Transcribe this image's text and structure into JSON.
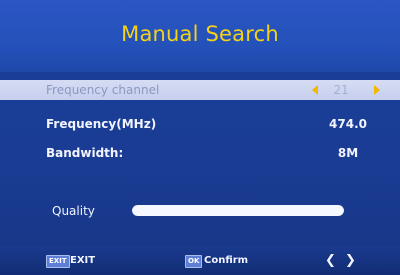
{
  "title": "Manual Search",
  "rows": [
    {
      "label": "Frequency channel",
      "value": "21"
    },
    {
      "label": "Frequency(MHz)",
      "value": "474.0"
    },
    {
      "label": "Bandwidth:",
      "value": "8M"
    }
  ],
  "quality": {
    "label": "Quality",
    "level": 1.0
  },
  "footer": {
    "exit_key": "EXIT",
    "exit_label": "EXIT",
    "ok_key": "OK",
    "confirm_label": "Confirm",
    "nav_left": "❮",
    "nav_right": "❯"
  },
  "colors": {
    "background": "#1a3c93",
    "title": "#f4d21a",
    "highlight_row": "#d6dcf3",
    "arrow": "#f2b700"
  }
}
